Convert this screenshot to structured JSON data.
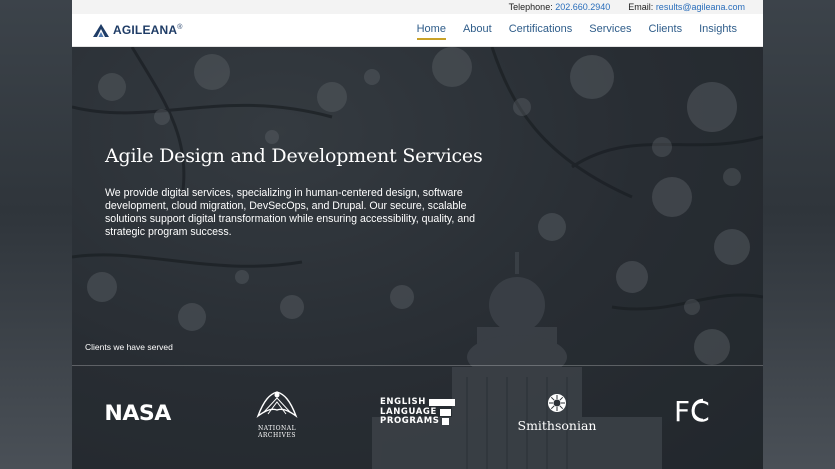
{
  "topbar": {
    "telephone_label": "Telephone:",
    "telephone": "202.660.2940",
    "email_label": "Email:",
    "email": "results@agileana.com"
  },
  "header": {
    "brand": "AGILEANA",
    "brand_mark": "®",
    "nav": [
      {
        "label": "Home",
        "active": true
      },
      {
        "label": "About"
      },
      {
        "label": "Certifications"
      },
      {
        "label": "Services"
      },
      {
        "label": "Clients"
      },
      {
        "label": "Insights"
      }
    ]
  },
  "hero": {
    "title": "Agile Design and Development Services",
    "description": "We provide digital services, specializing in human-centered design, software development, cloud migration, DevSecOps, and Drupal. Our secure, scalable solutions support digital transformation while ensuring accessibility, quality, and strategic program success."
  },
  "clients": {
    "label": "Clients we have served",
    "logos": {
      "nasa": "NASA",
      "archives_line1": "NATIONAL",
      "archives_line2": "ARCHIVES",
      "elp_line1": "ENGLISH",
      "elp_line2": "LANGUAGE",
      "elp_line3": "PROGRAMS",
      "smithsonian": "Smithsonian",
      "fcc": "FC"
    }
  },
  "colors": {
    "accent_underline": "#c9a227",
    "nav_text": "#2f5d8a",
    "link": "#2a6ebb",
    "brand": "#1f3c66"
  }
}
